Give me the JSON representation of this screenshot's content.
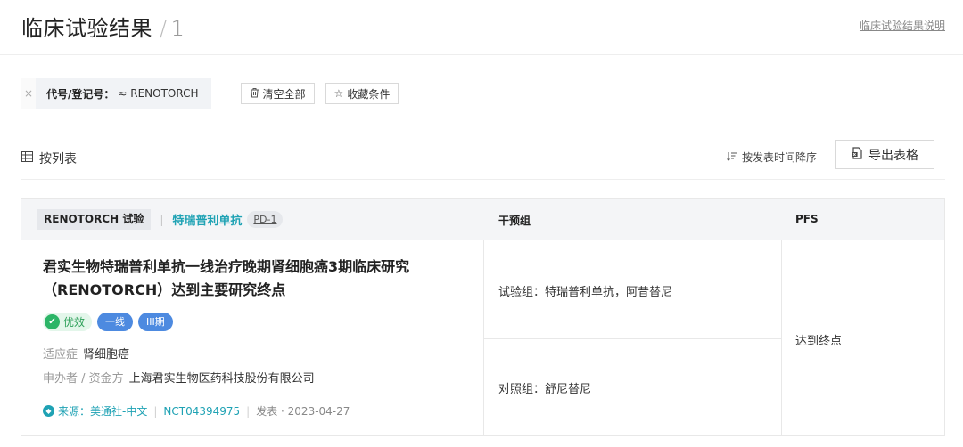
{
  "header": {
    "title": "临床试验结果",
    "separator": "/",
    "count": "1",
    "help_link": "临床试验结果说明"
  },
  "filter": {
    "chip_close": "×",
    "chip_key": "代号/登记号：",
    "chip_value": "≈ RENOTORCH",
    "clear_all": "清空全部",
    "save_conditions": "收藏条件"
  },
  "view": {
    "toggle_label": "按列表",
    "sort_label": "按发表时间降序",
    "export_label": "导出表格"
  },
  "table": {
    "trial_tag": "RENOTORCH 试验",
    "separator": "|",
    "drug_name": "特瑞普利单抗",
    "target_tag": "PD-1",
    "col_arm": "干预组",
    "col_pfs": "PFS"
  },
  "row": {
    "title": "君实生物特瑞普利单抗一线治疗晚期肾细胞癌3期临床研究（RENOTORCH）达到主要研究终点",
    "badge_good": "优效",
    "badge_line": "一线",
    "badge_phase": "III期",
    "indication_label": "适应症",
    "indication_value": "肾细胞癌",
    "sponsor_label": "申办者 / 资金方",
    "sponsor_value": "上海君实生物医药科技股份有限公司",
    "source_prefix": "来源：",
    "source_name": "美通社-中文",
    "nct": "NCT04394975",
    "published": "发表 · 2023-04-27",
    "arm_experimental": "试验组：特瑞普利单抗，阿昔替尼",
    "arm_control": "对照组：舒尼替尼",
    "pfs_result": "达到终点"
  },
  "icons": {
    "trash": "trash-icon",
    "star": "star-icon",
    "list": "list-icon",
    "sort": "sort-icon",
    "export": "export-icon",
    "shield": "shield-check-icon",
    "source": "source-icon"
  },
  "colors": {
    "accent_teal": "#1fa2b4",
    "badge_blue": "#4d8ae0",
    "badge_green": "#2cb567"
  }
}
